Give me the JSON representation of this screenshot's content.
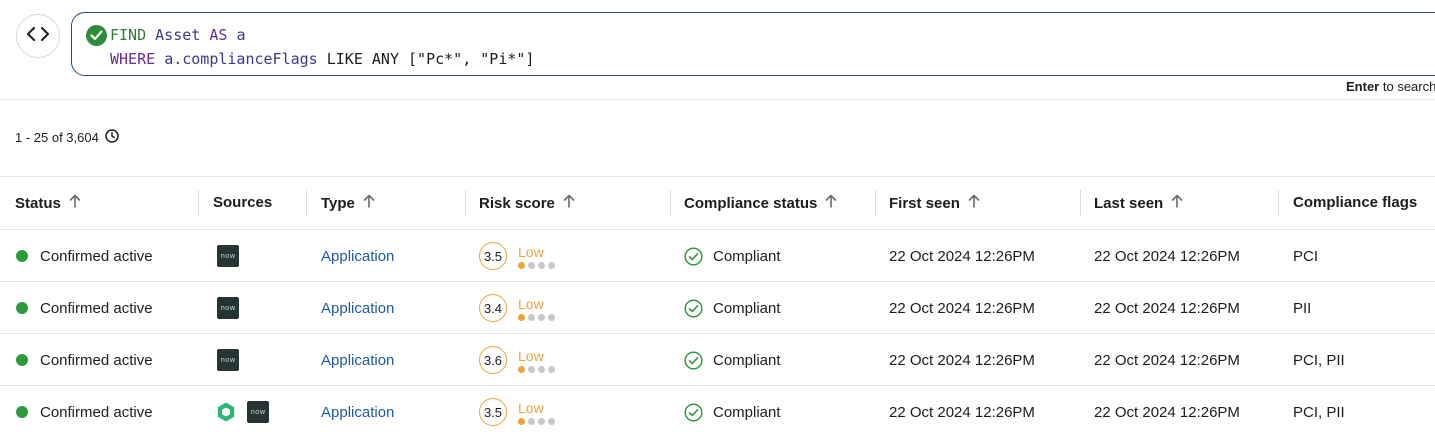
{
  "query": {
    "line1": {
      "find": "FIND",
      "entity": "Asset",
      "as": "AS",
      "alias": "a"
    },
    "line2": {
      "where": "WHERE",
      "field": "a.complianceFlags",
      "rest": "LIKE ANY [\"Pc*\", \"Pi*\"]"
    },
    "status_icon": "check-circle-icon",
    "hint_key": "Enter",
    "hint_text": "to search"
  },
  "results": {
    "count_text": "1 - 25 of 3,604",
    "icon": "clock-icon"
  },
  "columns": [
    {
      "label": "Status",
      "sortable": true
    },
    {
      "label": "Sources",
      "sortable": false
    },
    {
      "label": "Type",
      "sortable": true
    },
    {
      "label": "Risk score",
      "sortable": true
    },
    {
      "label": "Compliance status",
      "sortable": true
    },
    {
      "label": "First seen",
      "sortable": true
    },
    {
      "label": "Last seen",
      "sortable": true
    },
    {
      "label": "Compliance flags",
      "sortable": false
    }
  ],
  "rows": [
    {
      "status": "Confirmed active",
      "sources": [
        "now"
      ],
      "type": "Application",
      "risk_score": "3.5",
      "risk_level": "Low",
      "risk_dots_filled": 1,
      "compliance": "Compliant",
      "first_seen": "22 Oct 2024 12:26PM",
      "last_seen": "22 Oct 2024 12:26PM",
      "flags": "PCI"
    },
    {
      "status": "Confirmed active",
      "sources": [
        "now"
      ],
      "type": "Application",
      "risk_score": "3.4",
      "risk_level": "Low",
      "risk_dots_filled": 1,
      "compliance": "Compliant",
      "first_seen": "22 Oct 2024 12:26PM",
      "last_seen": "22 Oct 2024 12:26PM",
      "flags": "PII"
    },
    {
      "status": "Confirmed active",
      "sources": [
        "now"
      ],
      "type": "Application",
      "risk_score": "3.6",
      "risk_level": "Low",
      "risk_dots_filled": 1,
      "compliance": "Compliant",
      "first_seen": "22 Oct 2024 12:26PM",
      "last_seen": "22 Oct 2024 12:26PM",
      "flags": "PCI, PII"
    },
    {
      "status": "Confirmed active",
      "sources": [
        "hexagon",
        "now"
      ],
      "type": "Application",
      "risk_score": "3.5",
      "risk_level": "Low",
      "risk_dots_filled": 1,
      "compliance": "Compliant",
      "first_seen": "22 Oct 2024 12:26PM",
      "last_seen": "22 Oct 2024 12:26PM",
      "flags": "PCI, PII"
    }
  ],
  "source_icon_text": {
    "now": "now"
  },
  "colors": {
    "status_active": "#2e9a3f",
    "risk_low": "#f0a23a",
    "link": "#1d5ba5",
    "compliant": "#2e9a3f"
  }
}
